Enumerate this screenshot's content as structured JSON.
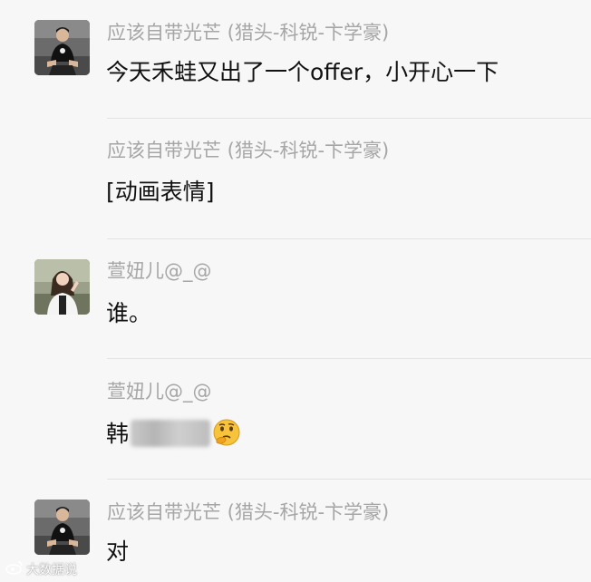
{
  "messages": [
    {
      "sender": "应该自带光芒 (猎头-科锐-卞学豪)",
      "text": "今天禾蛙又出了一个offer，小开心一下",
      "avatar": "man-black-tshirt"
    },
    {
      "sender": "应该自带光芒 (猎头-科锐-卞学豪)",
      "text": "[动画表情]"
    },
    {
      "sender": "萱妞儿@_@",
      "text": "谁。",
      "avatar": "woman-white-top"
    },
    {
      "sender": "萱妞儿@_@",
      "text_prefix": "韩",
      "emoji": "thinking-emoji"
    },
    {
      "sender": "应该自带光芒 (猎头-科锐-卞学豪)",
      "text": "对",
      "avatar": "man-black-tshirt"
    }
  ],
  "watermark": {
    "text": "大数据说",
    "icon": "weibo-icon"
  }
}
